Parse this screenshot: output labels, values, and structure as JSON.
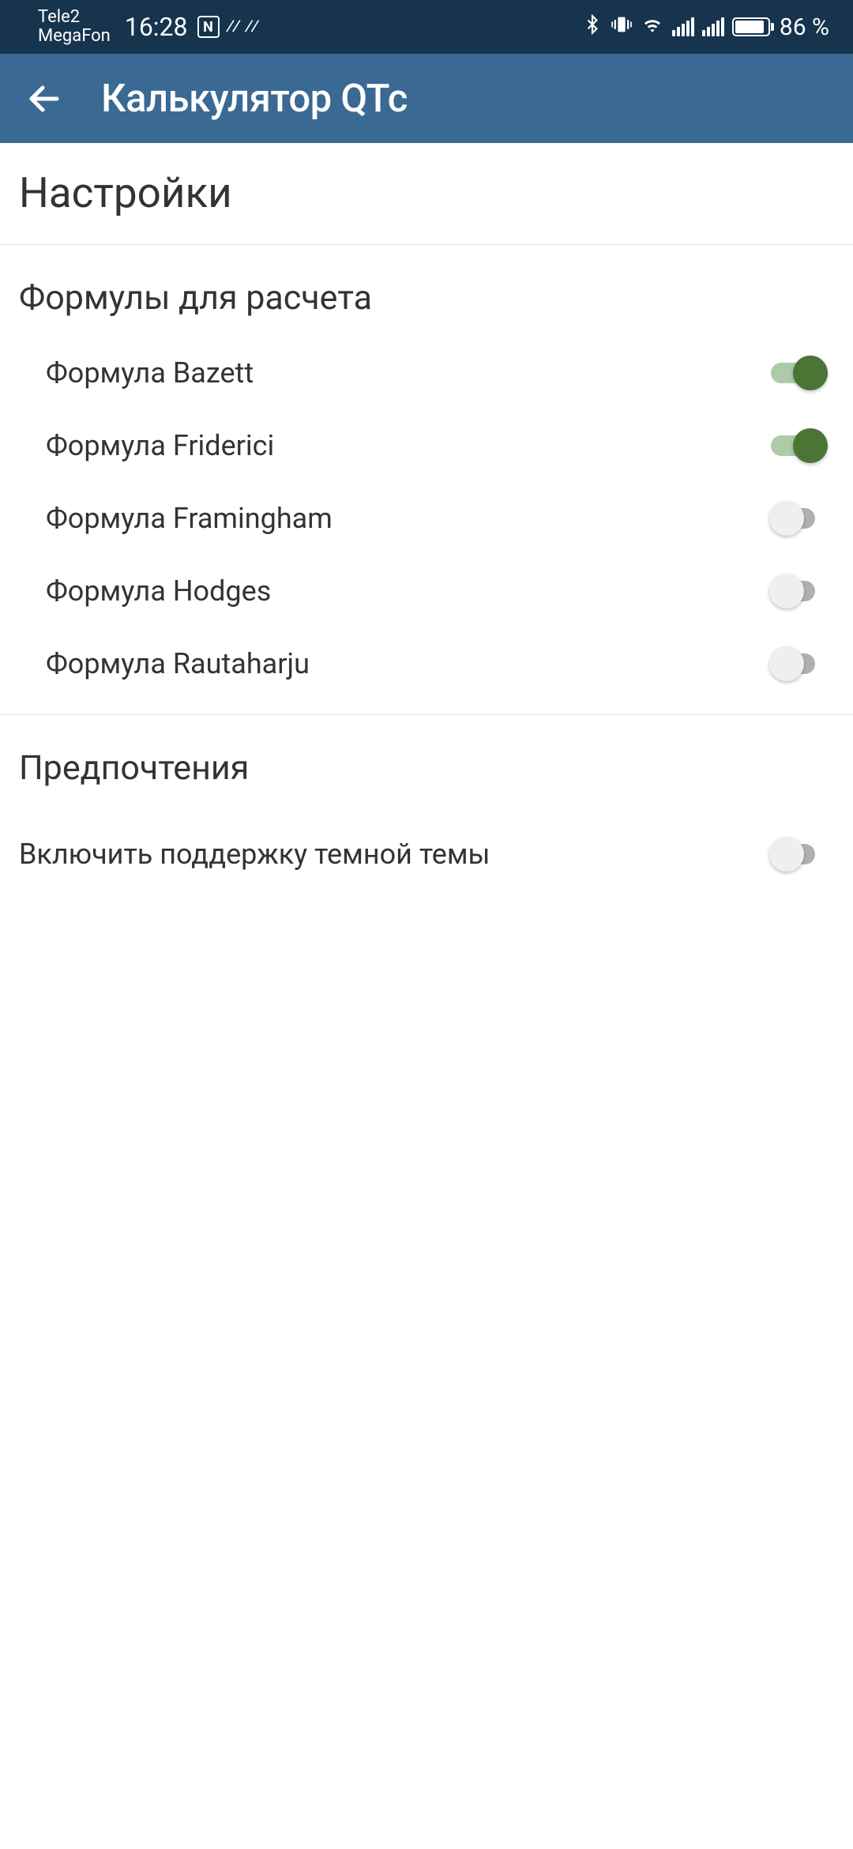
{
  "status": {
    "carrier1": "Tele2",
    "carrier2": "MegaFon",
    "time": "16:28",
    "battery": "86 %"
  },
  "header": {
    "title": "Калькулятор QTc"
  },
  "page": {
    "title": "Настройки"
  },
  "sections": {
    "formulas": {
      "title": "Формулы для расчета",
      "items": [
        {
          "label": "Формула Bazett",
          "on": true
        },
        {
          "label": "Формула Friderici",
          "on": true
        },
        {
          "label": "Формула Framingham",
          "on": false
        },
        {
          "label": "Формула Hodges",
          "on": false
        },
        {
          "label": "Формула Rautaharju",
          "on": false
        }
      ]
    },
    "preferences": {
      "title": "Предпочтения",
      "items": [
        {
          "label": "Включить поддержку темной темы",
          "on": false
        }
      ]
    }
  }
}
